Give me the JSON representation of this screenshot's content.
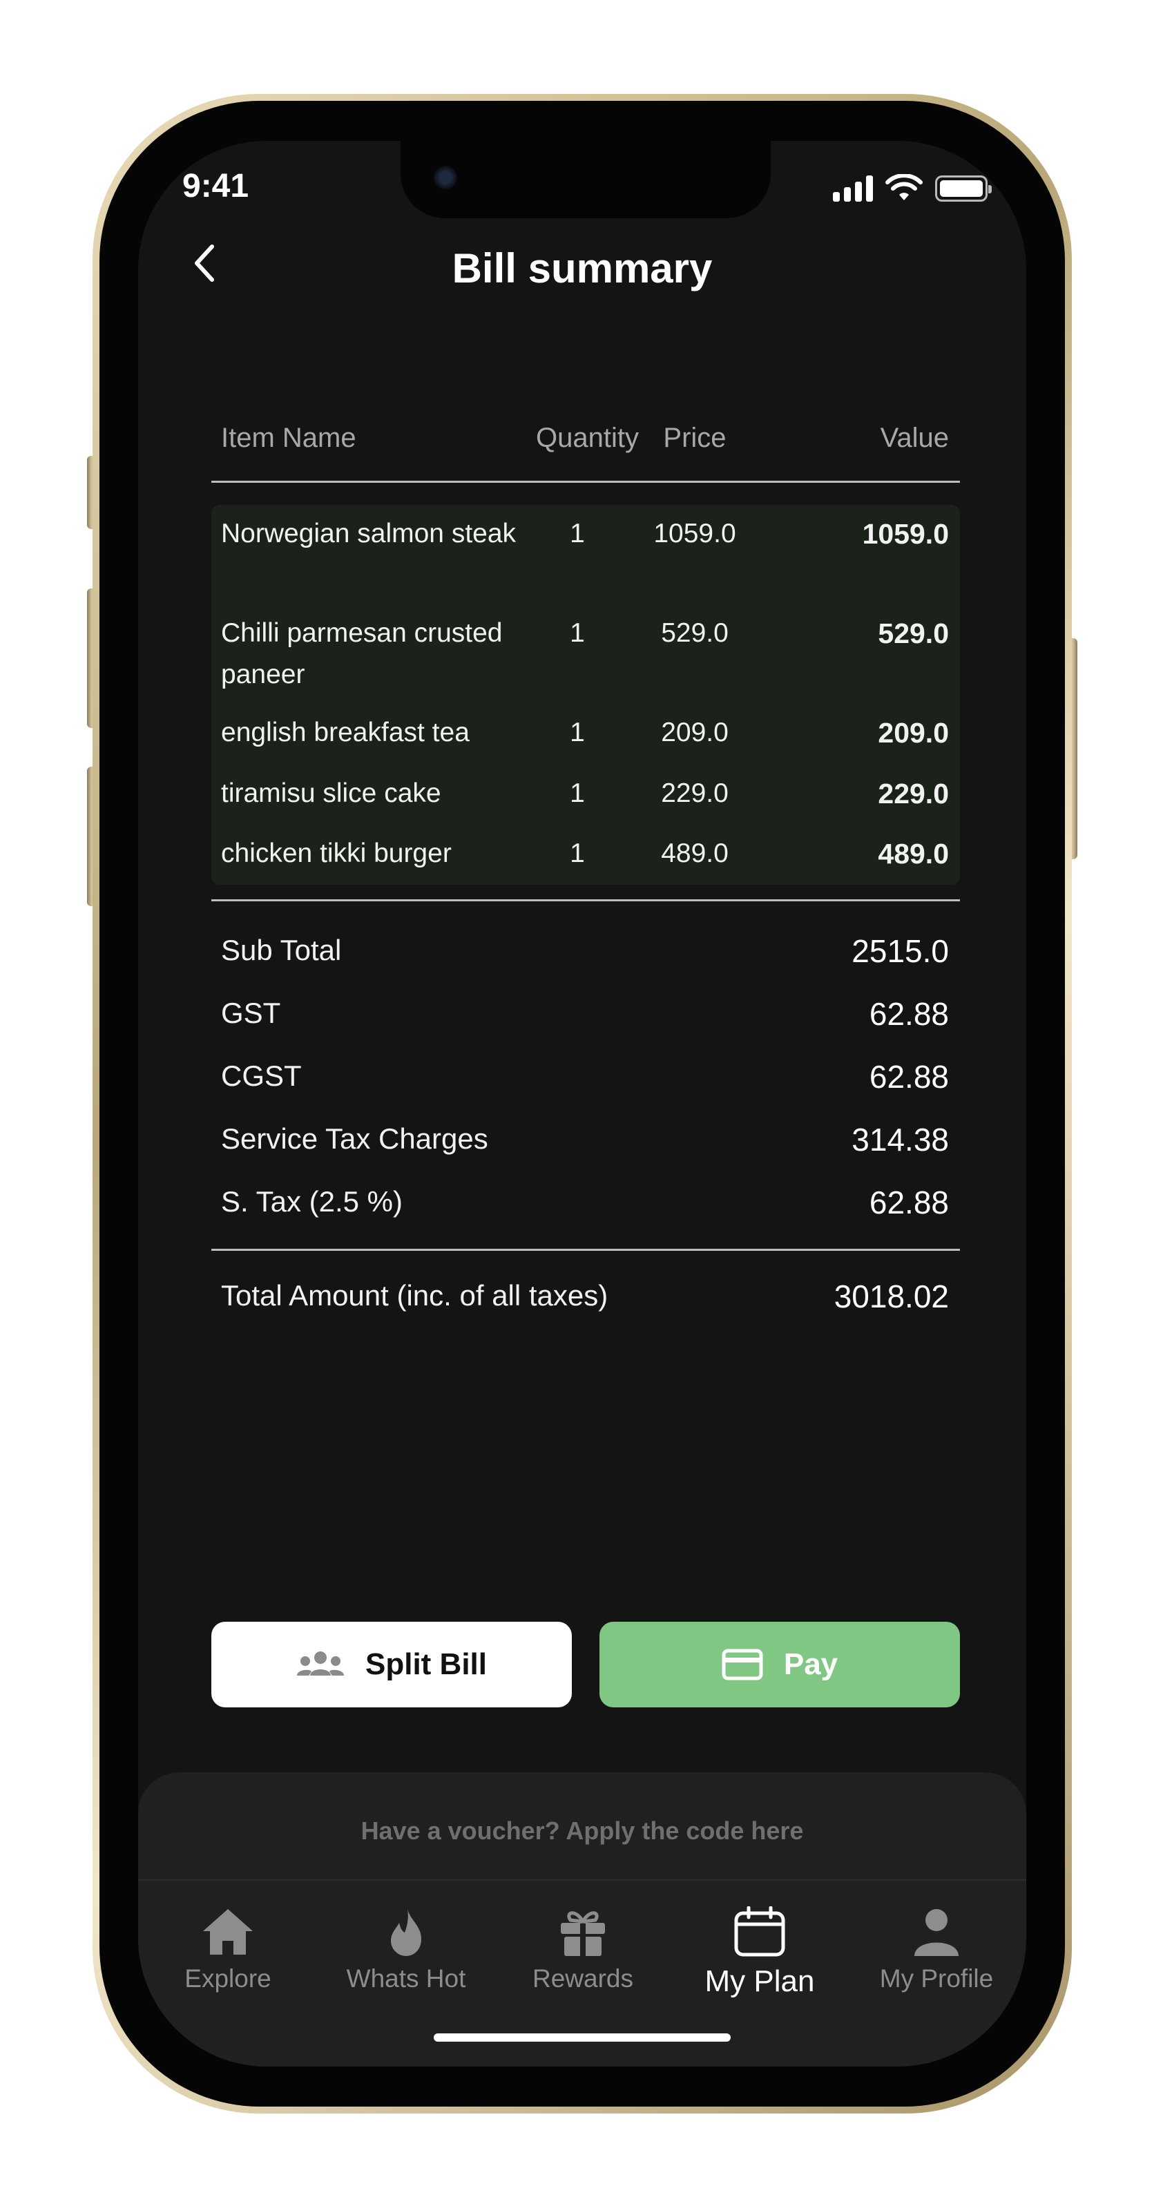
{
  "status_bar": {
    "time": "9:41"
  },
  "header": {
    "title": "Bill summary",
    "back_icon": "chevron-left-icon"
  },
  "table": {
    "columns": [
      "Item Name",
      "Quantity",
      "Price",
      "Value"
    ],
    "rows": [
      {
        "name": "Norwegian salmon steak",
        "quantity": "1",
        "price": "1059.0",
        "value": "1059.0"
      },
      {
        "name": "Chilli parmesan crusted paneer",
        "quantity": "1",
        "price": "529.0",
        "value": "529.0"
      },
      {
        "name": "english breakfast tea",
        "quantity": "1",
        "price": "209.0",
        "value": "209.0"
      },
      {
        "name": "tiramisu slice cake",
        "quantity": "1",
        "price": "229.0",
        "value": "229.0"
      },
      {
        "name": "chicken tikki burger",
        "quantity": "1",
        "price": "489.0",
        "value": "489.0"
      }
    ]
  },
  "summary": {
    "rows": [
      {
        "label": "Sub Total",
        "value": "2515.0"
      },
      {
        "label": "GST",
        "value": "62.88"
      },
      {
        "label": "CGST",
        "value": "62.88"
      },
      {
        "label": "Service Tax Charges",
        "value": "314.38"
      },
      {
        "label": "S. Tax  (2.5 %)",
        "value": "62.88"
      }
    ],
    "total": {
      "label": "Total Amount (inc. of all taxes)",
      "value": "3018.02"
    }
  },
  "actions": {
    "split_label": "Split Bill",
    "split_icon": "group-icon",
    "pay_label": "Pay",
    "pay_icon": "credit-card-icon"
  },
  "voucher": {
    "text": "Have a voucher? Apply the code here"
  },
  "tabs": [
    {
      "label": "Explore",
      "icon": "home-icon",
      "active": false
    },
    {
      "label": "Whats Hot",
      "icon": "flame-icon",
      "active": false
    },
    {
      "label": "Rewards",
      "icon": "gift-icon",
      "active": false
    },
    {
      "label": "My Plan",
      "icon": "calendar-icon",
      "active": true
    },
    {
      "label": "My Profile",
      "icon": "person-icon",
      "active": false
    }
  ],
  "colors": {
    "background": "#141414",
    "items_background": "#1a2219",
    "pay_button": "#81c784",
    "split_button": "#ffffff",
    "inactive_tab": "#8d8d8d"
  }
}
